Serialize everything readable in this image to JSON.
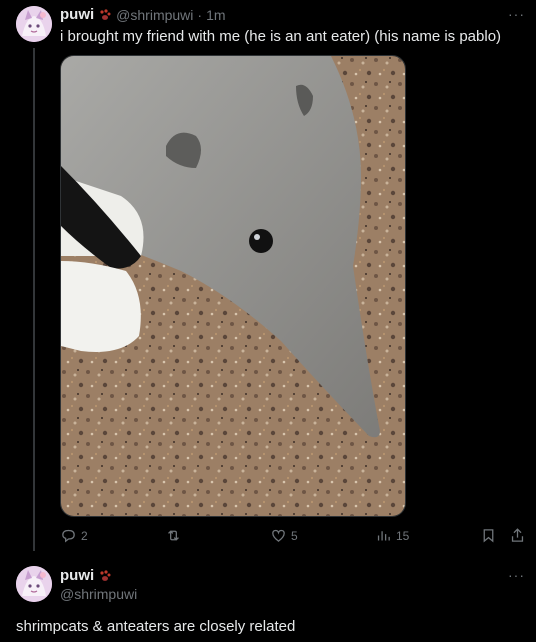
{
  "post1": {
    "author_name": "puwi",
    "handle": "@shrimpuwi",
    "separator": "·",
    "time": "1m",
    "text": "i brought my friend with me (he is an ant eater) (his name is pablo)",
    "more_label": "···",
    "actions": {
      "replies": "2",
      "reposts": "",
      "likes": "5",
      "views": "15"
    }
  },
  "post2": {
    "author_name": "puwi",
    "handle": "@shrimpuwi",
    "more_label": "···",
    "text": "shrimpcats & anteaters are closely related"
  },
  "colors": {
    "background": "#000000",
    "text": "#e7e9ea",
    "muted": "#71767b",
    "divider": "#333639"
  },
  "icons": {
    "badge": "paw-icon",
    "reply": "reply-icon",
    "repost": "repost-icon",
    "like": "heart-icon",
    "views": "views-icon",
    "bookmark": "bookmark-icon",
    "share": "share-icon"
  }
}
